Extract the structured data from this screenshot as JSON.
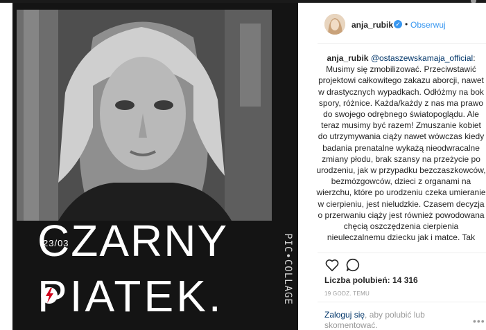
{
  "header": {
    "username": "anja_rubik",
    "separator": "•",
    "follow_label": "Obserwuj"
  },
  "media": {
    "caption_date": "23/03",
    "caption_line1": "CZARNY",
    "caption_line2": "PIATEK.",
    "watermark": "PIC•COLLAGE"
  },
  "comment": {
    "username": "anja_rubik",
    "mention": "@ostaszewskamaja_official",
    "text": ": Musimy się zmobilizować. Przeciwstawić projektowi całkowitego zakazu aborcji, nawet w drastycznych wypadkach. Odłóżmy na bok spory, różnice. Każda/każdy z nas ma prawo do swojego odrębnego światopoglądu. Ale teraz musimy być razem! Zmuszanie kobiet do utrzymywania ciąży nawet wówczas kiedy badania prenatalne wykażą nieodwracalne zmiany płodu, brak szansy na przeżycie po urodzeniu, jak w przypadku bezczaszkowców, bezmózgowców, dzieci z organami na wierzchu, które po urodzeniu czeka umieranie w cierpieniu, jest nieludzkie. Czasem decyzja o przerwaniu ciąży jest również powodowana chęcią oszczędzenia cierpienia nieuleczalnemu dziecku jak i matce. Tak"
  },
  "stats": {
    "likes_label": "Liczba polubień:",
    "likes_count": "14 316",
    "timestamp": "19 GODZ. TEMU"
  },
  "footer": {
    "login_link": "Zaloguj się",
    "login_rest": ", aby polubić lub skomentować.",
    "more": "•••"
  },
  "icons": {
    "verified": "verified-badge-icon",
    "like": "heart-icon",
    "comment": "comment-bubble-icon",
    "more": "more-options-icon"
  },
  "colors": {
    "accent": "#3897f0",
    "link": "#003569",
    "muted": "#999999",
    "text": "#262626",
    "media_bg": "#141414"
  }
}
